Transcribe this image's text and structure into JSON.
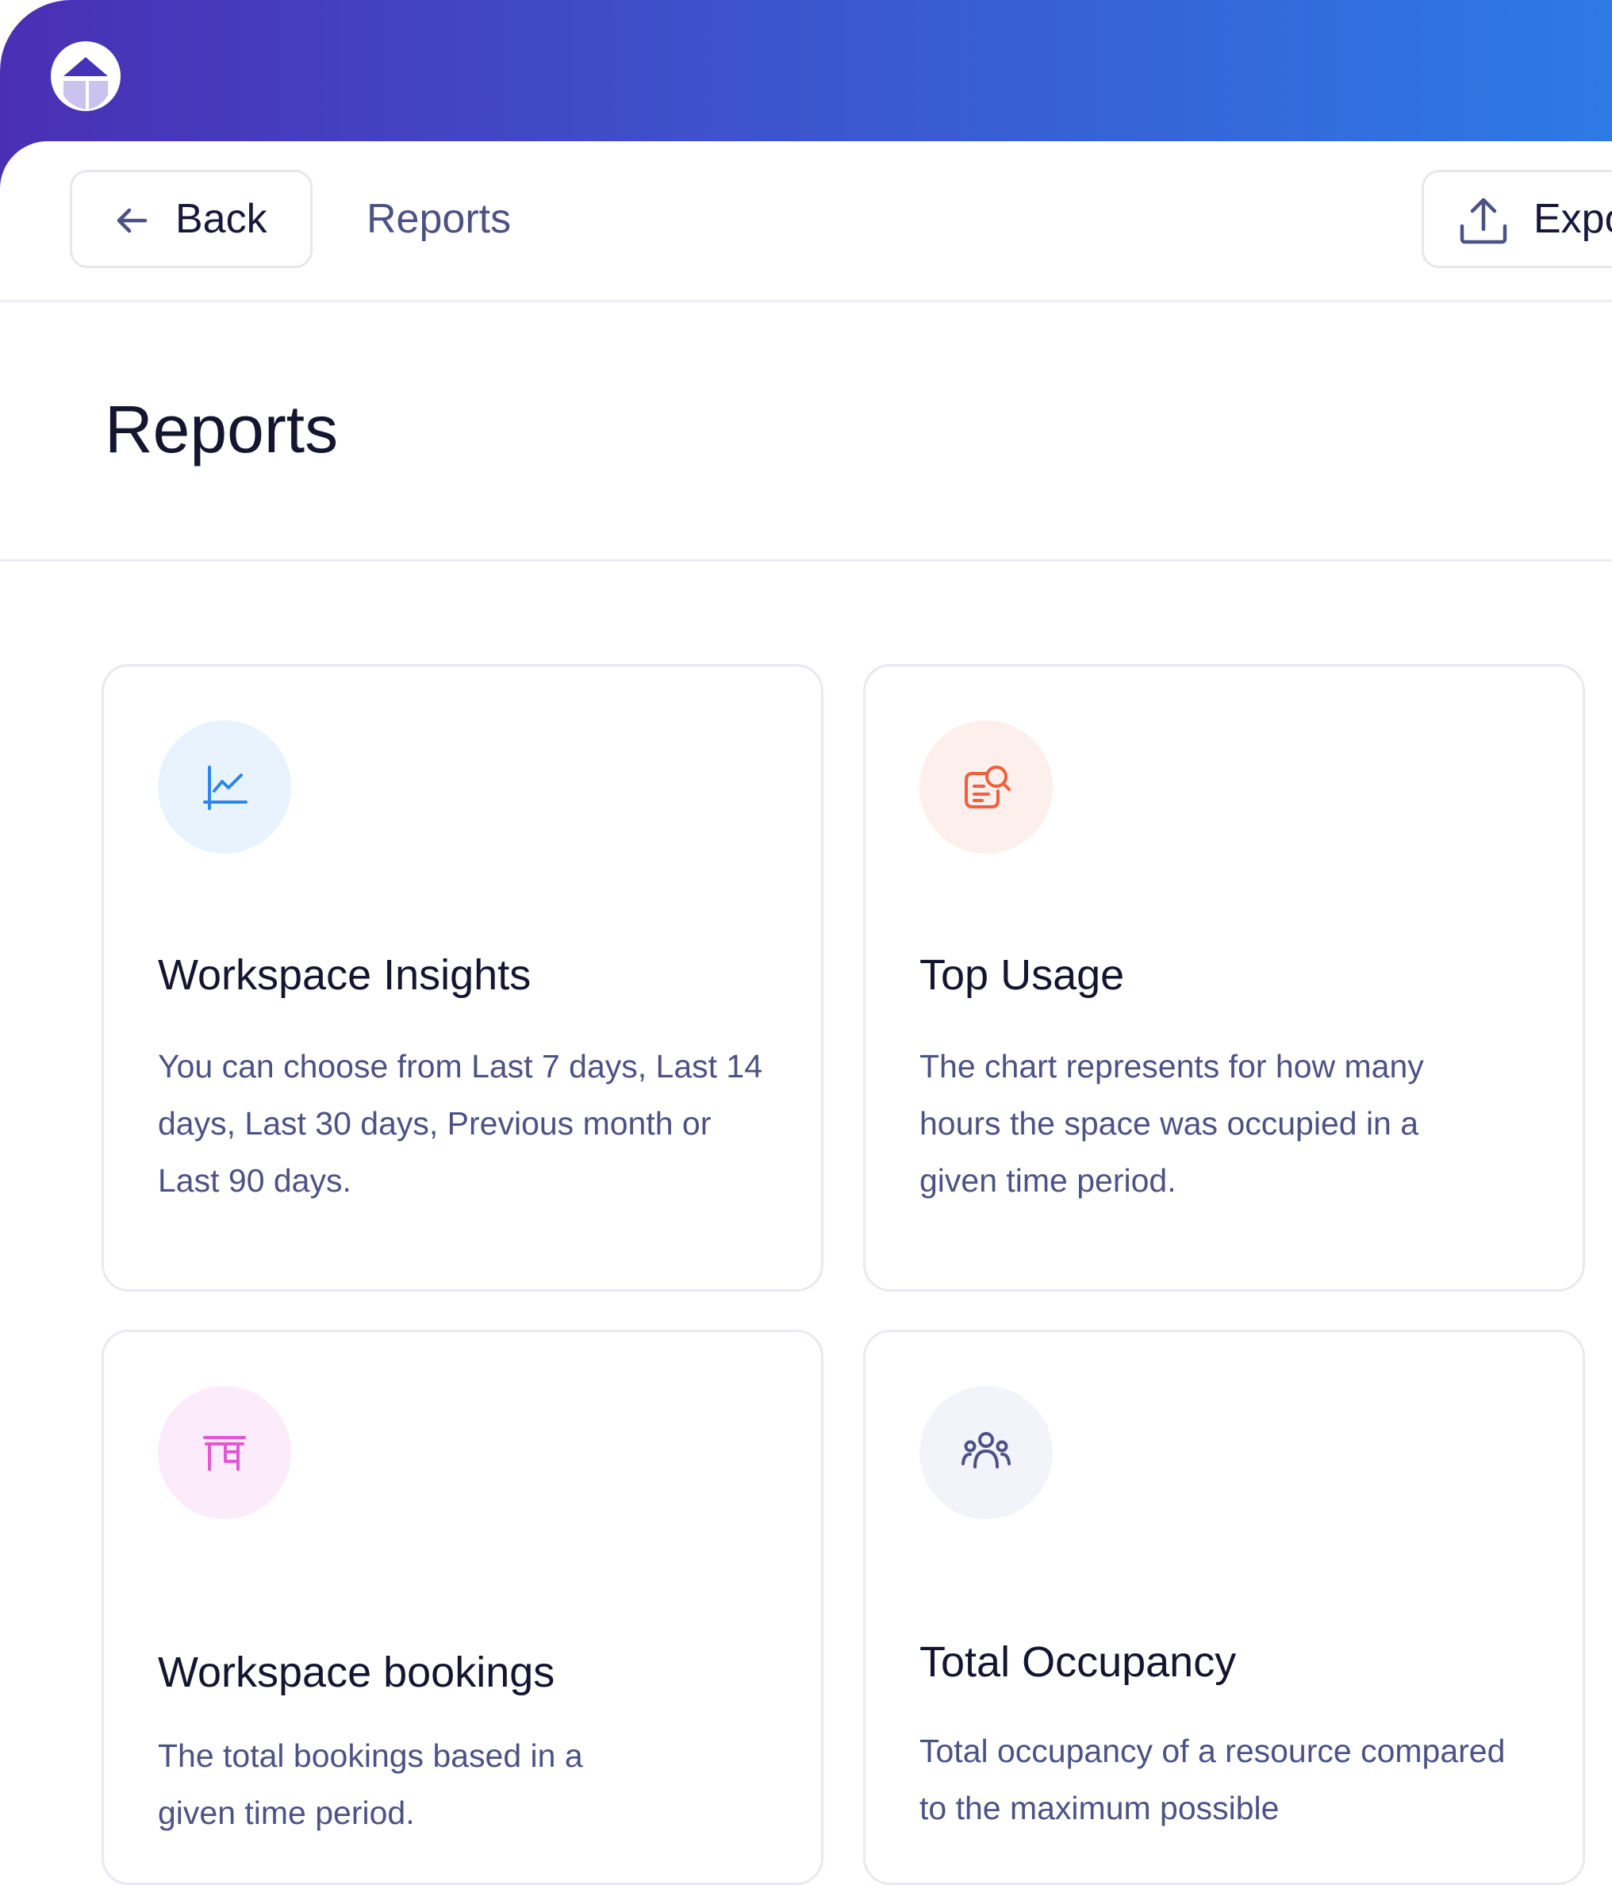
{
  "toolbar": {
    "back_label": "Back",
    "breadcrumb": "Reports",
    "export_label": "Export"
  },
  "page": {
    "title": "Reports"
  },
  "cards": [
    {
      "title": "Workspace Insights",
      "description": "You can choose from Last 7 days, Last 14 days, Last 30 days, Previous month or Last 90 days.",
      "icon": "line-chart-icon",
      "accent": "#2d86e8",
      "icon_bg": "#e9f3fd"
    },
    {
      "title": "Top Usage",
      "description": "The chart represents for how many hours the space was occupied in a given time period.",
      "icon": "document-search-icon",
      "accent": "#f0603c",
      "icon_bg": "#fdefec"
    },
    {
      "title": "Workspace bookings",
      "description": "The total bookings based in a given time period.",
      "icon": "desk-icon",
      "accent": "#e556d6",
      "icon_bg": "#fcecfb"
    },
    {
      "title": "Total Occupancy",
      "description": "Total occupancy of a resource compared to the maximum possible",
      "icon": "people-group-icon",
      "accent": "#4d5285",
      "icon_bg": "#f3f4fa"
    }
  ],
  "colors": {
    "header_gradient_start": "#4a2fb4",
    "header_gradient_end": "#2d7ae4",
    "text_primary": "#14152f",
    "text_secondary": "#4d5285"
  }
}
